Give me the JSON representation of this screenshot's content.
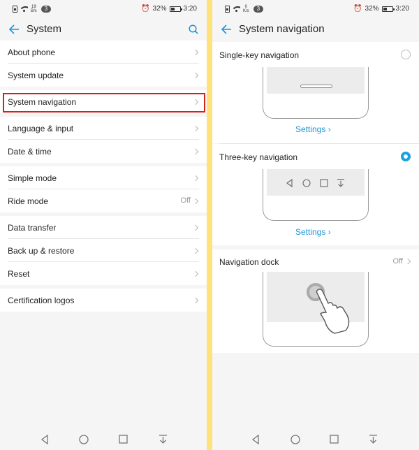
{
  "status_bar": {
    "left_speed_value": "19",
    "left_speed_unit": "B/s",
    "right_speed_value": "0",
    "right_speed_unit": "K/s",
    "notif_count": "3",
    "battery": "32%",
    "time": "3:20"
  },
  "left_screen": {
    "title": "System",
    "groups": [
      [
        {
          "label": "About phone"
        },
        {
          "label": "System update"
        }
      ],
      [
        {
          "label": "System navigation"
        }
      ],
      [
        {
          "label": "Language & input"
        },
        {
          "label": "Date & time"
        }
      ],
      [
        {
          "label": "Simple mode"
        },
        {
          "label": "Ride mode",
          "value": "Off"
        }
      ],
      [
        {
          "label": "Data transfer"
        },
        {
          "label": "Back up & restore"
        },
        {
          "label": "Reset"
        }
      ],
      [
        {
          "label": "Certification logos"
        }
      ]
    ]
  },
  "right_screen": {
    "title": "System navigation",
    "single_key": {
      "label": "Single-key navigation",
      "settings": "Settings",
      "selected": false
    },
    "three_key": {
      "label": "Three-key navigation",
      "settings": "Settings",
      "selected": true
    },
    "nav_dock": {
      "label": "Navigation dock",
      "value": "Off"
    }
  },
  "colors": {
    "accent": "#1ba0e2",
    "highlight": "#d32020",
    "divider": "#ffe27a"
  },
  "icons": [
    "back-arrow-icon",
    "search-icon",
    "chevron-right-icon",
    "back-triangle-icon",
    "home-circle-icon",
    "recents-square-icon",
    "notification-pull-icon",
    "hand-pointer-icon"
  ]
}
